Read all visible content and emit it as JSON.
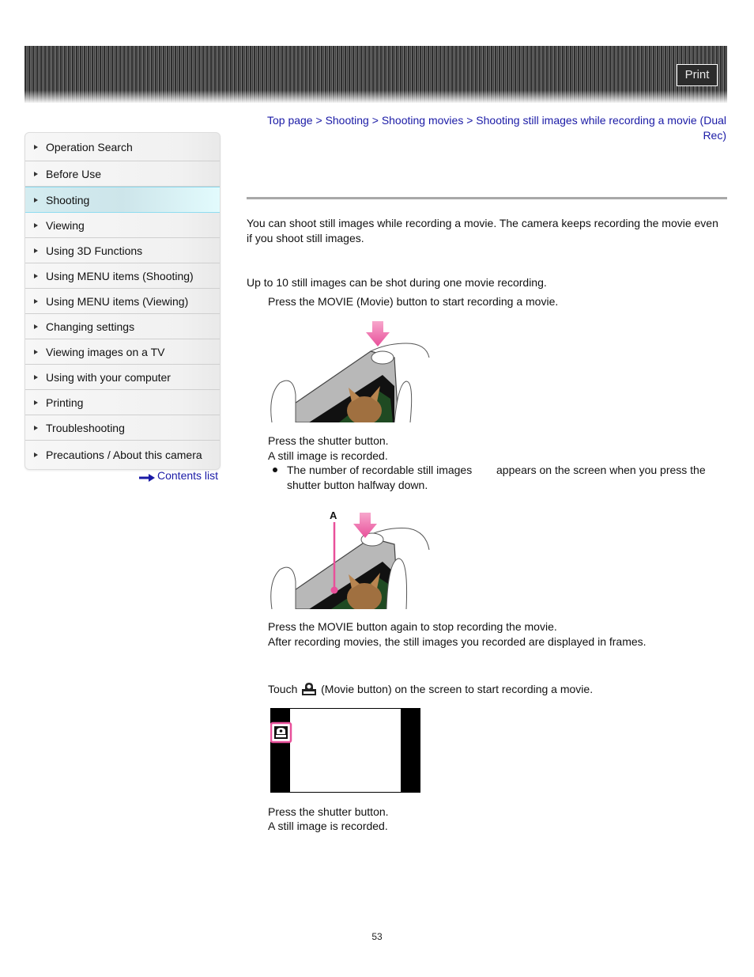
{
  "header": {
    "print_label": "Print"
  },
  "sidebar": {
    "items": [
      {
        "label": "Operation Search",
        "active": false
      },
      {
        "label": "Before Use",
        "active": false
      },
      {
        "label": "Shooting",
        "active": true
      },
      {
        "label": "Viewing",
        "active": false
      },
      {
        "label": "Using 3D Functions",
        "active": false
      },
      {
        "label": "Using MENU items (Shooting)",
        "active": false
      },
      {
        "label": "Using MENU items (Viewing)",
        "active": false
      },
      {
        "label": "Changing settings",
        "active": false
      },
      {
        "label": "Viewing images on a TV",
        "active": false
      },
      {
        "label": "Using with your computer",
        "active": false
      },
      {
        "label": "Printing",
        "active": false
      },
      {
        "label": "Troubleshooting",
        "active": false
      },
      {
        "label": "Precautions / About this camera",
        "active": false
      }
    ],
    "contents_link": "Contents list"
  },
  "breadcrumb": {
    "items": [
      "Top page",
      "Shooting",
      "Shooting movies",
      "Shooting still images while recording a movie (Dual Rec)"
    ],
    "separator": ">"
  },
  "content": {
    "intro_line1": "You can shoot still images while recording a movie. The camera keeps recording the movie even",
    "intro_line2": "if you shoot still images.",
    "note": "Up to 10 still images can be shot during one movie recording.",
    "step1": "Press the MOVIE (Movie) button to start recording a movie.",
    "step2_line1": "Press the shutter button.",
    "step2_line2": "A still image is recorded.",
    "bullet_part1": "The number of recordable still images",
    "bullet_part2": "appears on the screen when you press the",
    "bullet_line2": "shutter button halfway down.",
    "callout_label": "A",
    "step3_line1": "Press the MOVIE button again to stop recording the movie.",
    "step3_line2": "After recording movies, the still images you recorded are displayed in frames.",
    "touch_prefix": "Touch",
    "touch_suffix": "(Movie button) on the screen to start recording a movie.",
    "movie_icon_text": "MOVIE",
    "step4_line1": "Press the shutter button.",
    "step4_line2": "A still image is recorded."
  },
  "colors": {
    "link": "#1a1aa6",
    "accent_pink": "#e8509a",
    "active_nav": "#d4ecf0"
  },
  "page_number": "53"
}
